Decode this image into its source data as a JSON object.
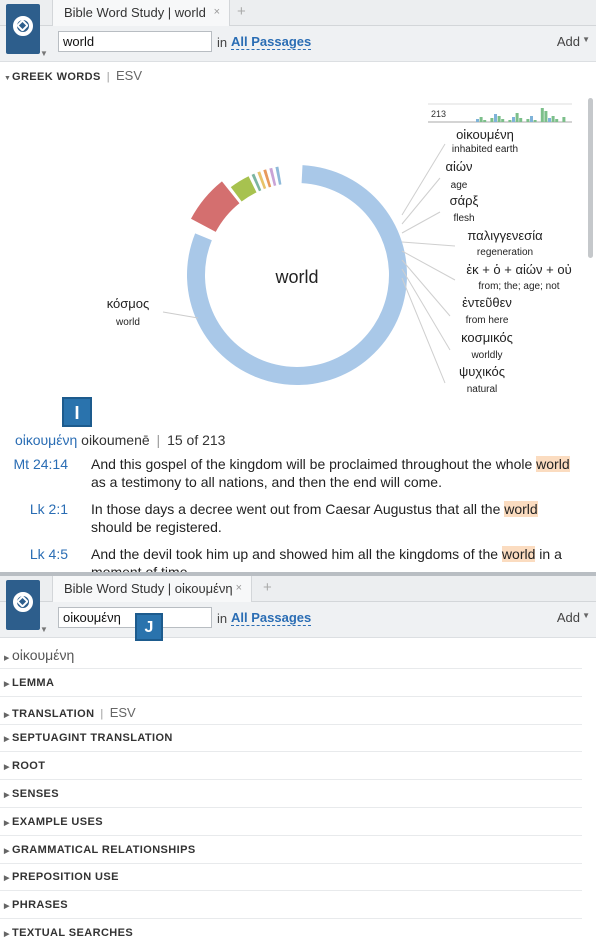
{
  "panel1": {
    "tab_title": "Bible Word Study | world",
    "tab_close": "×",
    "tab_add": "+",
    "search_value": "world",
    "in_label": "in",
    "passages_label": "All Passages",
    "add_label": "Add",
    "section_title": "GREEK WORDS",
    "section_version": "ESV",
    "separator": "|",
    "center_word": "world",
    "histogram_max": "213",
    "left_word": {
      "greek": "κόσμος",
      "gloss": "world"
    },
    "right_words": [
      {
        "greek": "οἰκουμένη",
        "gloss": "inhabited earth"
      },
      {
        "greek": "αἰών",
        "gloss": "age"
      },
      {
        "greek": "σάρξ",
        "gloss": "flesh"
      },
      {
        "greek": "παλιγγενεσία",
        "gloss": "regeneration"
      },
      {
        "greek": "ἐκ + ὁ + αἰών + οὐ",
        "gloss": "from; the; age; not"
      },
      {
        "greek": "ἐντεῦθεν",
        "gloss": "from here"
      },
      {
        "greek": "κοσμικός",
        "gloss": "worldly"
      },
      {
        "greek": "ψυχικός",
        "gloss": "natural"
      }
    ],
    "donut_segments": [
      {
        "word": "κόσμος",
        "value": 186,
        "color": "#a9c8e8"
      },
      {
        "word": "οἰκουμένη",
        "value": 15,
        "color": "#d46f6f"
      },
      {
        "word": "αἰών",
        "value": 7,
        "color": "#a7c24f"
      },
      {
        "word": "σάρξ",
        "value": 1,
        "color": "#7cb5a0"
      },
      {
        "word": "παλιγγενεσία",
        "value": 1,
        "color": "#e8c36a"
      },
      {
        "word": "ἐκ + ὁ + αἰών + οὐ",
        "value": 1,
        "color": "#e89a5c"
      },
      {
        "word": "ἐντεῦθεν",
        "value": 1,
        "color": "#c9a3d6"
      },
      {
        "word": "κοσμικός",
        "value": 1,
        "color": "#8fb9d9"
      }
    ],
    "callout_i": "I",
    "headword": {
      "greek": "οἰκουμένη",
      "translit": "oikoumenē",
      "count": "15 of 213"
    },
    "verses": [
      {
        "ref": "Mt 24:14",
        "before": "And this gospel of the kingdom will be proclaimed throughout the whole ",
        "hl": "world",
        "after": " as a testimony to all nations, and then the end will come."
      },
      {
        "ref": "Lk 2:1",
        "before": "In those days a decree went out from Caesar Augustus that all the ",
        "hl": "world",
        "after": " should be registered."
      },
      {
        "ref": "Lk 4:5",
        "before": "And the devil took him up and showed him all the kingdoms of the ",
        "hl": "world",
        "after": " in a moment of time,"
      }
    ]
  },
  "panel2": {
    "tab_title": "Bible Word Study | οἰκουμένη",
    "tab_close": "×",
    "tab_add": "+",
    "search_value": "οἰκουμένη",
    "callout_j": "J",
    "in_label": "in",
    "passages_label": "All Passages",
    "add_label": "Add",
    "sections": [
      {
        "label": "οἰκουμένη",
        "greek": true
      },
      {
        "label": "LEMMA"
      },
      {
        "label": "TRANSLATION",
        "version": "ESV"
      },
      {
        "label": "SEPTUAGINT TRANSLATION"
      },
      {
        "label": "ROOT"
      },
      {
        "label": "SENSES"
      },
      {
        "label": "EXAMPLE USES"
      },
      {
        "label": "GRAMMATICAL RELATIONSHIPS"
      },
      {
        "label": "PREPOSITION USE"
      },
      {
        "label": "PHRASES"
      },
      {
        "label": "TEXTUAL SEARCHES"
      }
    ]
  }
}
